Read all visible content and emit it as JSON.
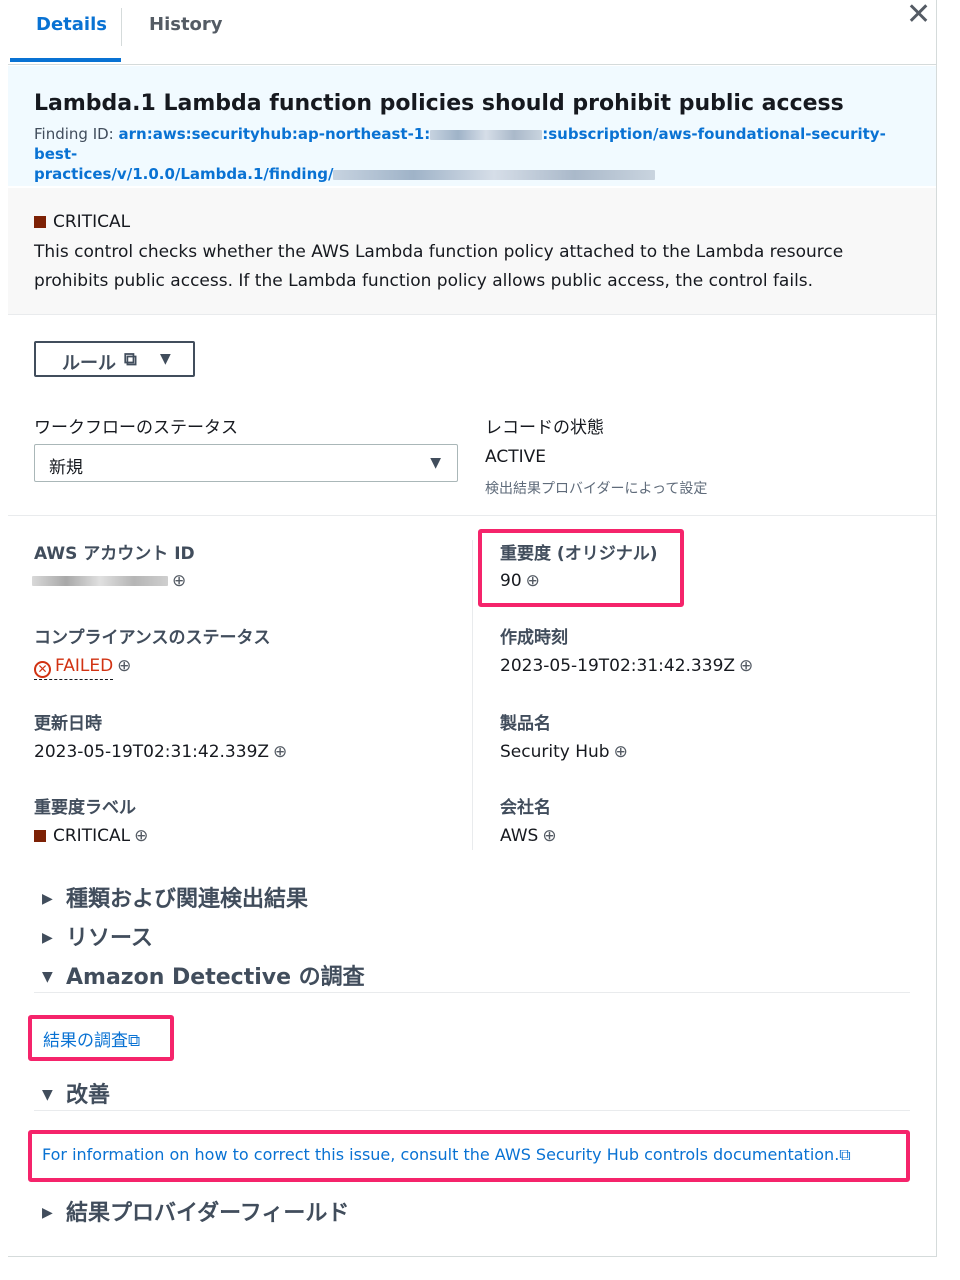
{
  "tabs": {
    "details": "Details",
    "history": "History"
  },
  "close": "✕",
  "finding": {
    "title": "Lambda.1 Lambda function policies should prohibit public access",
    "id_label": "Finding ID:",
    "id_part1": "arn:aws:securityhub:ap-northeast-1:",
    "id_part2": ":subscription/aws-foundational-security-best-",
    "id_part3": "practices/v/1.0.0/Lambda.1/finding/"
  },
  "severity_header": "CRITICAL",
  "description": "This control checks whether the AWS Lambda function policy attached to the Lambda resource prohibits public access. If the Lambda function policy allows public access, the control fails.",
  "rule_button": {
    "label": "ルール",
    "ext_icon": "⧉",
    "caret": "▼"
  },
  "workflow": {
    "label": "ワークフローのステータス",
    "value": "新規",
    "caret": "▼"
  },
  "record_state": {
    "label": "レコードの状態",
    "value": "ACTIVE",
    "note": "検出結果プロバイダーによって設定"
  },
  "fields": {
    "account_id_label": "AWS アカウント ID",
    "severity_original_label": "重要度 (オリジナル)",
    "severity_original_value": "90",
    "compliance_label": "コンプライアンスのステータス",
    "compliance_value": "FAILED",
    "created_label": "作成時刻",
    "created_value": "2023-05-19T02:31:42.339Z",
    "updated_label": "更新日時",
    "updated_value": "2023-05-19T02:31:42.339Z",
    "product_label": "製品名",
    "product_value": "Security Hub",
    "severity_label_label": "重要度ラベル",
    "severity_label_value": "CRITICAL",
    "company_label": "会社名",
    "company_value": "AWS"
  },
  "sections": {
    "types": "種類および関連検出結果",
    "resources": "リソース",
    "detective": "Amazon Detective の調査",
    "detective_link": "結果の調査",
    "remediation": "改善",
    "remediation_link": "For information on how to correct this issue, consult the AWS Security Hub controls documentation.",
    "provider_fields": "結果プロバイダーフィールド"
  },
  "colors": {
    "accent": "#0972d3",
    "critical": "#7d2105",
    "failed": "#d13212",
    "highlight": "#f5246b"
  }
}
